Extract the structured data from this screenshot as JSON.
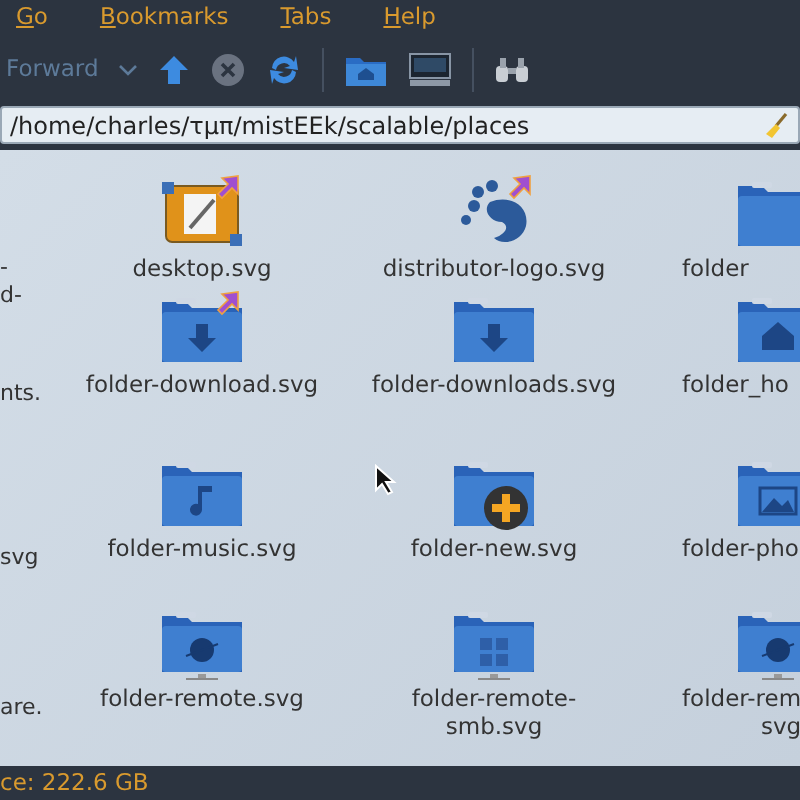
{
  "menu": [
    {
      "label": "Go"
    },
    {
      "label": "Bookmarks"
    },
    {
      "label": "Tabs"
    },
    {
      "label": "Help"
    }
  ],
  "toolbar": {
    "forward": {
      "label": "Forward",
      "disabled": true
    },
    "stop": {
      "disabled": true
    }
  },
  "address": {
    "value": "/home/charles/τμπ/mistEEk/scalable/places"
  },
  "left_fragments": [
    [
      "-",
      "d-"
    ],
    [
      "nts."
    ],
    [
      "svg"
    ],
    [
      "are."
    ]
  ],
  "files": [
    {
      "label": "desktop.svg",
      "kind": "desktop",
      "link": true
    },
    {
      "label": "distributor-logo.svg",
      "kind": "logo",
      "link": true
    },
    {
      "label": "folder-download.svg",
      "kind": "download",
      "link": true
    },
    {
      "label": "folder-downloads.svg",
      "kind": "download",
      "link": false
    },
    {
      "label": "folder-music.svg",
      "kind": "music",
      "link": false
    },
    {
      "label": "folder-new.svg",
      "kind": "new",
      "link": false
    },
    {
      "label": "folder-remote.svg",
      "kind": "remote",
      "link": false
    },
    {
      "label": "folder-remote-smb.svg",
      "kind": "smb",
      "link": false
    }
  ],
  "right_fragments": [
    {
      "label": "folder",
      "kind": "plain"
    },
    {
      "label": "folder_ho",
      "kind": "home"
    },
    {
      "label": "folder-pho",
      "kind": "photo"
    },
    {
      "label": "folder-rem\nsvg",
      "kind": "remote"
    }
  ],
  "status": "ce: 222.6 GB"
}
